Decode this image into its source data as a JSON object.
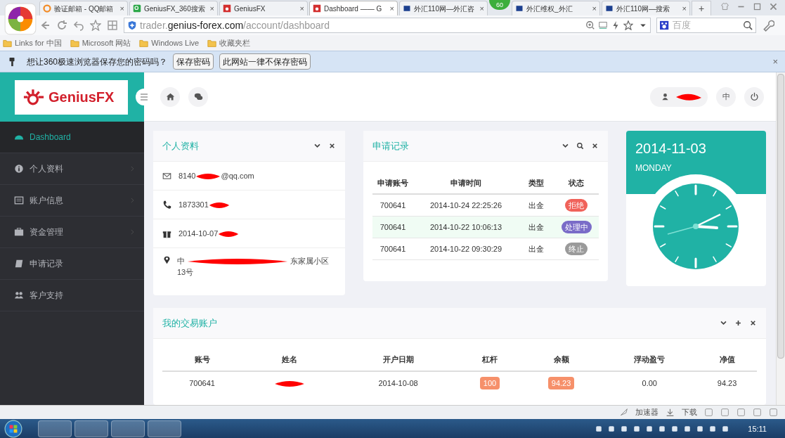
{
  "browser": {
    "tabs": [
      {
        "title": "验证邮箱 - QQ邮箱",
        "selected": false,
        "close": "×"
      },
      {
        "title": "GeniusFX_360搜索",
        "selected": false,
        "close": "×"
      },
      {
        "title": "GeniusFX",
        "selected": false,
        "close": "×"
      },
      {
        "title": "Dashboard —— G",
        "selected": true,
        "close": "×"
      },
      {
        "title": "外汇110网—外汇咨",
        "selected": false,
        "close": "×"
      },
      {
        "title": "外汇维权_外汇",
        "selected": false,
        "close": "×"
      },
      {
        "title": "外汇110网—搜索",
        "selected": false,
        "close": "×"
      }
    ],
    "badge": "60",
    "new_tab": "+",
    "url": {
      "sub": "trader.",
      "domain": "genius-forex.com",
      "path": "/account/dashboard"
    },
    "search_placeholder": "百度",
    "bookmarks": [
      "Links for 中国",
      "Microsoft 网站",
      "Windows Live",
      "收藏夹栏"
    ],
    "password_bar": {
      "message": "想让360极速浏览器保存您的密码吗？",
      "buttons": [
        "保存密码",
        "此网站一律不保存密码"
      ],
      "close": "×"
    }
  },
  "app": {
    "logo": "GeniusFX",
    "user_lang": "中",
    "sidebar": [
      {
        "label": "Dashboard",
        "selected": true,
        "has_arrow": false
      },
      {
        "label": "个人资料",
        "selected": false,
        "has_arrow": true
      },
      {
        "label": "账户信息",
        "selected": false,
        "has_arrow": true
      },
      {
        "label": "资金管理",
        "selected": false,
        "has_arrow": true
      },
      {
        "label": "申请记录",
        "selected": false,
        "has_arrow": false
      },
      {
        "label": "客户支持",
        "selected": false,
        "has_arrow": false
      }
    ],
    "profile": {
      "title": "个人资料",
      "rows": [
        {
          "parts": [
            "8140",
            "@qq.com"
          ]
        },
        {
          "parts": [
            "1873301"
          ]
        },
        {
          "parts": [
            "2014-10-07"
          ]
        },
        {
          "parts": [
            "中",
            "东家属小区13号"
          ]
        }
      ]
    },
    "records": {
      "title": "申请记录",
      "columns": [
        "申请账号",
        "申请时间",
        "类型",
        "状态"
      ],
      "rows": [
        {
          "account": "700641",
          "time": "2014-10-24 22:25:26",
          "type": "出金",
          "status": "拒绝",
          "color": "#f0625a",
          "selected": false
        },
        {
          "account": "700641",
          "time": "2014-10-22 10:06:13",
          "type": "出金",
          "status": "处理中",
          "color": "#7a6cc8",
          "selected": true
        },
        {
          "account": "700641",
          "time": "2014-10-22 09:30:29",
          "type": "出金",
          "status": "终止",
          "color": "#9a9a9a",
          "selected": false
        }
      ]
    },
    "clock": {
      "date": "2014-11-03",
      "weekday": "MONDAY"
    },
    "accounts": {
      "title": "我的交易账户",
      "columns": [
        "账号",
        "姓名",
        "开户日期",
        "杠杆",
        "余额",
        "浮动盈亏",
        "净值"
      ],
      "rows": [
        [
          "700641",
          "",
          "2014-10-08",
          "100",
          "94.23",
          "0.00",
          "94.23"
        ]
      ]
    }
  },
  "status_bar": [
    "加速器",
    "下载"
  ],
  "taskbar": {
    "time": "15:11"
  }
}
